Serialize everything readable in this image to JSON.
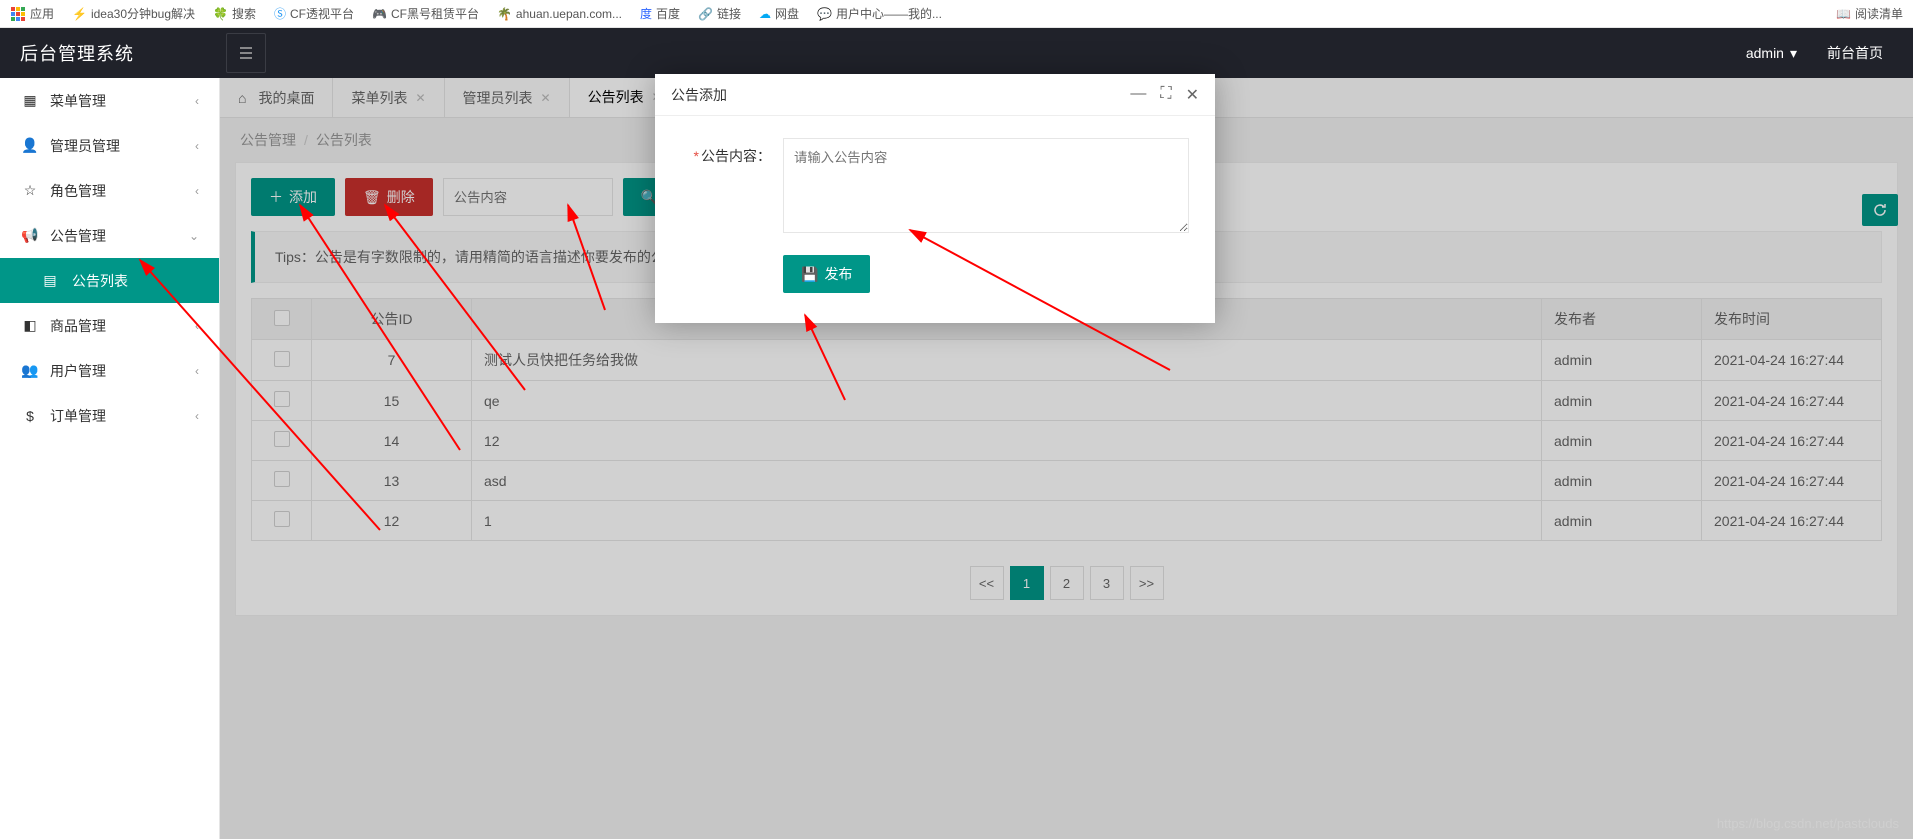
{
  "bookmarks": {
    "items": [
      "应用",
      "idea30分钟bug解决",
      "搜索",
      "CF透视平台",
      "CF黑号租赁平台",
      "ahuan.uepan.com...",
      "百度",
      "链接",
      "网盘",
      "用户中心——我的..."
    ],
    "right": "阅读清单"
  },
  "header": {
    "logo": "后台管理系统",
    "user": "admin",
    "front": "前台首页"
  },
  "sidebar": {
    "items": [
      {
        "label": "菜单管理",
        "chev": "‹"
      },
      {
        "label": "管理员管理",
        "chev": "‹"
      },
      {
        "label": "角色管理",
        "chev": "‹"
      },
      {
        "label": "公告管理",
        "chev": "⌄",
        "expanded": true
      },
      {
        "label": "公告列表",
        "active": true
      },
      {
        "label": "商品管理",
        "chev": "‹"
      },
      {
        "label": "用户管理",
        "chev": "‹"
      },
      {
        "label": "订单管理",
        "chev": "‹"
      }
    ]
  },
  "tabs": {
    "items": [
      {
        "label": "我的桌面",
        "home": true
      },
      {
        "label": "菜单列表",
        "closable": true
      },
      {
        "label": "管理员列表",
        "closable": true
      },
      {
        "label": "公告列表",
        "closable": true,
        "active": true
      }
    ]
  },
  "breadcrumb": {
    "a": "公告管理",
    "b": "公告列表"
  },
  "toolbar": {
    "add": "添加",
    "del": "删除",
    "search_placeholder": "公告内容",
    "search": "搜索"
  },
  "tips": "Tips：公告是有字数限制的，请用精简的语言描述你要发布的公告！",
  "table": {
    "headers": [
      "",
      "公告ID",
      "",
      "发布者",
      "发布时间"
    ],
    "rows": [
      {
        "id": "7",
        "content": "测试人员快把任务给我做",
        "publisher": "admin",
        "time": "2021-04-24 16:27:44"
      },
      {
        "id": "15",
        "content": "qe",
        "publisher": "admin",
        "time": "2021-04-24 16:27:44"
      },
      {
        "id": "14",
        "content": "12",
        "publisher": "admin",
        "time": "2021-04-24 16:27:44"
      },
      {
        "id": "13",
        "content": "asd",
        "publisher": "admin",
        "time": "2021-04-24 16:27:44"
      },
      {
        "id": "12",
        "content": "1",
        "publisher": "admin",
        "time": "2021-04-24 16:27:44"
      }
    ]
  },
  "pagination": {
    "first": "<<",
    "pages": [
      "1",
      "2",
      "3"
    ],
    "last": ">>",
    "active": "1"
  },
  "dialog": {
    "title": "公告添加",
    "label": "公告内容：",
    "placeholder": "请输入公告内容",
    "publish": "发布"
  },
  "watermark": "https://blog.csdn.net/pastclouds"
}
